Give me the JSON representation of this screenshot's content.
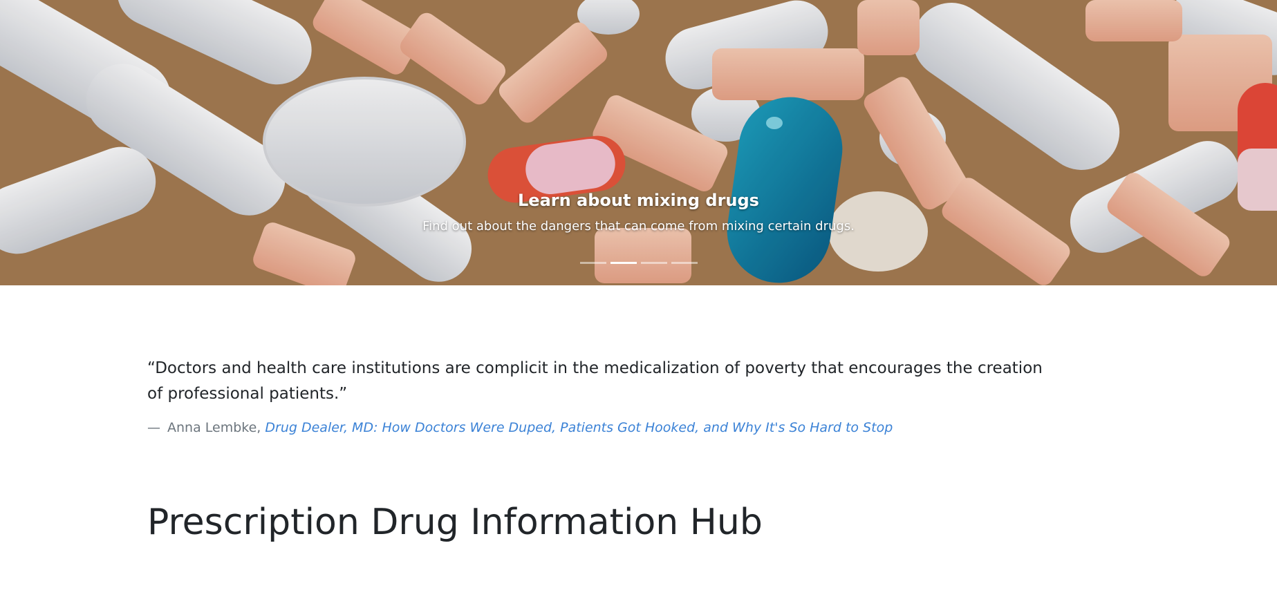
{
  "carousel": {
    "slide_title": "Learn about mixing drugs",
    "slide_text": "Find out about the dangers that can come from mixing certain drugs.",
    "indicator_count": 4,
    "active_index": 1
  },
  "quote": {
    "text": "“Doctors and health care institutions are complicit in the medicalization of poverty that encourages the creation of professional patients.”",
    "dash": "—",
    "author": "Anna Lembke,",
    "source_title": "Drug Dealer, MD: How Doctors Were Duped, Patients Got Hooked, and Why It's So Hard to Stop"
  },
  "page": {
    "title": "Prescription Drug Information Hub"
  },
  "colors": {
    "link": "#3b82d6",
    "text": "#212529",
    "muted": "#6c757d"
  }
}
